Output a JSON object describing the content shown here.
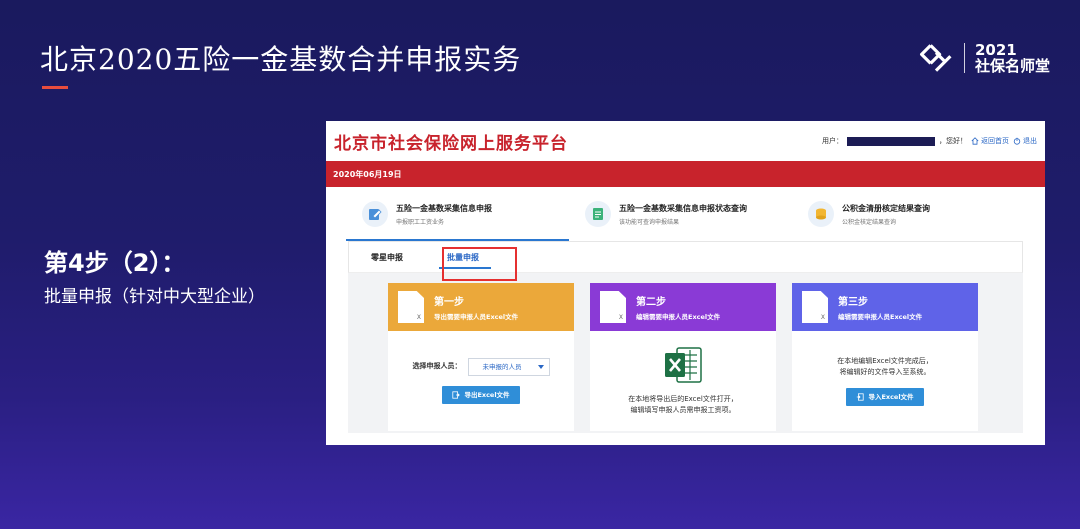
{
  "slide": {
    "title": "北京2020五险一金基数合并申报实务",
    "step_heading": "第4步（2）：",
    "step_sub": "批量申报（针对中大型企业）"
  },
  "brand": {
    "year": "2021",
    "name": "社保名师堂",
    "logo_icon": "brand-logo-icon"
  },
  "portal": {
    "title": "北京市社会保险网上服务平台",
    "user_prefix": "用户：",
    "user_suffix": "，您好！",
    "home_link": "返回首页",
    "logout_link": "退出",
    "date": "2020年06月19日",
    "modules": [
      {
        "title": "五险一金基数采集信息申报",
        "sub": "申报职工工资业务",
        "icon": "edit-icon"
      },
      {
        "title": "五险一金基数采集信息申报状态查询",
        "sub": "该功能可查询申报结果",
        "icon": "document-icon"
      },
      {
        "title": "公积金清册核定结果查询",
        "sub": "公积金核定结果查询",
        "icon": "coin-stack-icon"
      }
    ],
    "tabs": [
      "零星申报",
      "批量申报"
    ],
    "cards": [
      {
        "step": "第一步",
        "desc": "导出需要申报人员Excel文件",
        "select_label": "选择申报人员：",
        "select_value": "未申报的人员",
        "button": "导出Excel文件"
      },
      {
        "step": "第二步",
        "desc": "编辑需要申报人员Excel文件",
        "body_line1": "在本地将导出后的Excel文件打开，",
        "body_line2": "编辑填写申报人员需申报工资项。"
      },
      {
        "step": "第三步",
        "desc": "编辑需要申报人员Excel文件",
        "body_line1": "在本地编辑Excel文件完成后，",
        "body_line2": "将编辑好的文件导入至系统。",
        "button": "导入Excel文件"
      }
    ],
    "doc_ext": "X",
    "colors": {
      "red": "#c8232c",
      "step1": "#eba83a",
      "step2": "#8a3ad6",
      "step3": "#5f63e8",
      "button": "#2f8ed8"
    }
  }
}
